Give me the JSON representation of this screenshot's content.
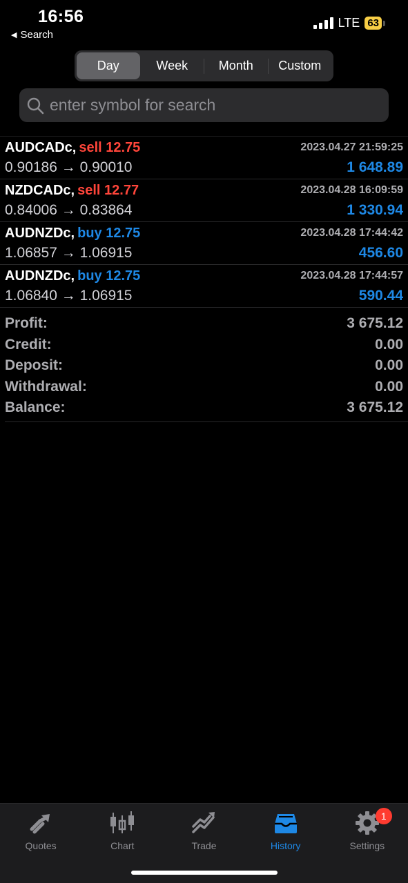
{
  "status": {
    "time": "16:56",
    "back_label": "Search",
    "network": "LTE",
    "battery": "63"
  },
  "periods": [
    "Day",
    "Week",
    "Month",
    "Custom"
  ],
  "active_period": "Day",
  "search": {
    "placeholder": "enter symbol for search"
  },
  "deals": [
    {
      "symbol": "AUDCADc,",
      "side": "sell 12.75",
      "direction": "sell",
      "date": "2023.04.27 21:59:25",
      "prices": "0.90186 → 0.90010",
      "profit": "1 648.89"
    },
    {
      "symbol": "NZDCADc,",
      "side": "sell 12.77",
      "direction": "sell",
      "date": "2023.04.28 16:09:59",
      "prices": "0.84006 → 0.83864",
      "profit": "1 330.94"
    },
    {
      "symbol": "AUDNZDc,",
      "side": "buy 12.75",
      "direction": "buy",
      "date": "2023.04.28 17:44:42",
      "prices": "1.06857 → 1.06915",
      "profit": "456.60"
    },
    {
      "symbol": "AUDNZDc,",
      "side": "buy 12.75",
      "direction": "buy",
      "date": "2023.04.28 17:44:57",
      "prices": "1.06840 → 1.06915",
      "profit": "590.44"
    }
  ],
  "summary": [
    {
      "label": "Profit:",
      "value": "3 675.12"
    },
    {
      "label": "Credit:",
      "value": "0.00"
    },
    {
      "label": "Deposit:",
      "value": "0.00"
    },
    {
      "label": "Withdrawal:",
      "value": "0.00"
    },
    {
      "label": "Balance:",
      "value": "3 675.12"
    }
  ],
  "tabs": [
    {
      "label": "Quotes",
      "icon": "quotes-icon"
    },
    {
      "label": "Chart",
      "icon": "chart-icon"
    },
    {
      "label": "Trade",
      "icon": "trade-icon"
    },
    {
      "label": "History",
      "icon": "history-icon"
    },
    {
      "label": "Settings",
      "icon": "gear-icon",
      "badge": "1"
    }
  ],
  "active_tab": "History",
  "colors": {
    "sell": "#ff453a",
    "buy": "#1e88e5",
    "accent": "#1e88e5",
    "badge": "#ff3b30"
  }
}
